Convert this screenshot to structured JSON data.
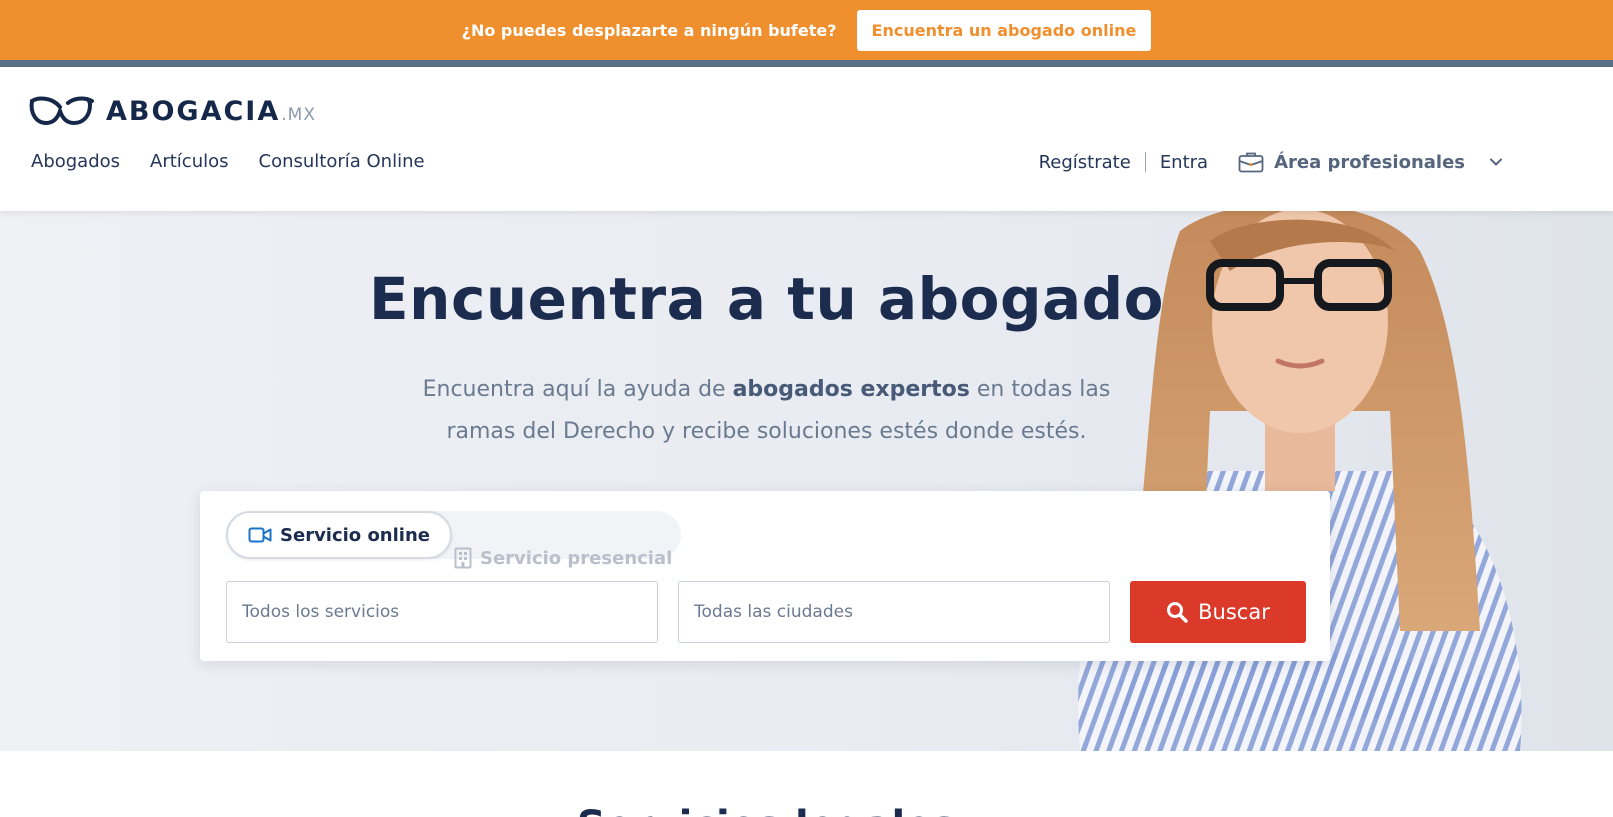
{
  "promo": {
    "text": "¿No puedes desplazarte a ningún bufete?",
    "button": "Encuentra un abogado online"
  },
  "header": {
    "logo": {
      "name": "ABOGACIA",
      "tld": ".MX"
    },
    "nav": [
      "Abogados",
      "Artículos",
      "Consultoría Online"
    ],
    "register": "Regístrate",
    "login": "Entra",
    "pro_area": "Área profesionales"
  },
  "hero": {
    "title": "Encuentra a tu abogado",
    "sub_before": "Encuentra aquí la ayuda de ",
    "sub_bold": "abogados expertos",
    "sub_after": " en todas las ramas del Derecho y recibe soluciones estés donde estés."
  },
  "search": {
    "tab_online": "Servicio online",
    "tab_presencial": "Servicio presencial",
    "services_placeholder": "Todos los servicios",
    "cities_placeholder": "Todas las ciudades",
    "button": "Buscar"
  },
  "section": {
    "title": "Servicios legales"
  },
  "colors": {
    "promo": "#f08f2e",
    "navy": "#1b2c4f",
    "search_button": "#db3a2b"
  }
}
